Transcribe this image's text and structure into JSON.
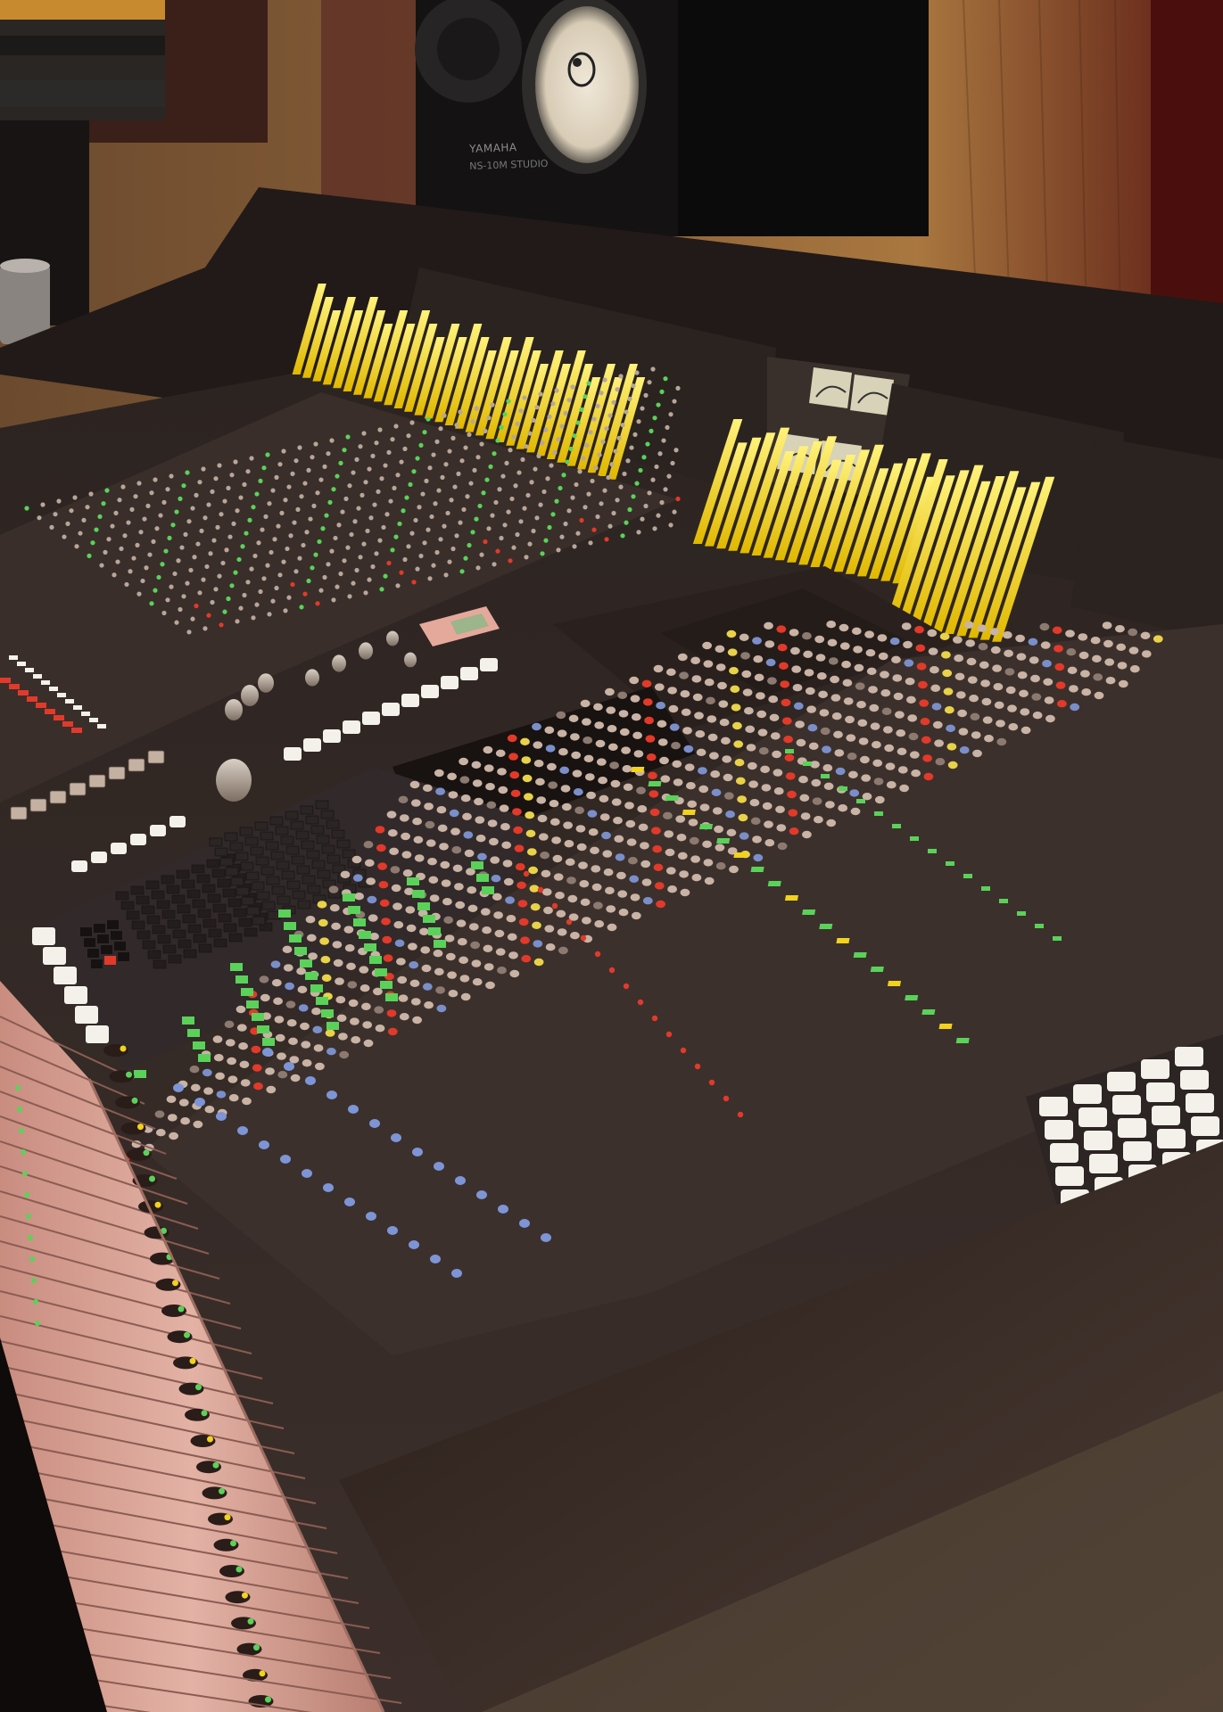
{
  "speaker": {
    "brand": "YAMAHA",
    "model": "NS-10M STUDIO"
  },
  "colors": {
    "meter_yellow": "#f2d21c",
    "meter_glow": "#ffe94a",
    "panel_surface": "#3b2e2a",
    "fader_strip": "#d9a497",
    "wood": "#9a6a3a",
    "led_red": "#e23a2a",
    "led_green": "#5ad25a",
    "button_white": "#f4f1ea"
  }
}
